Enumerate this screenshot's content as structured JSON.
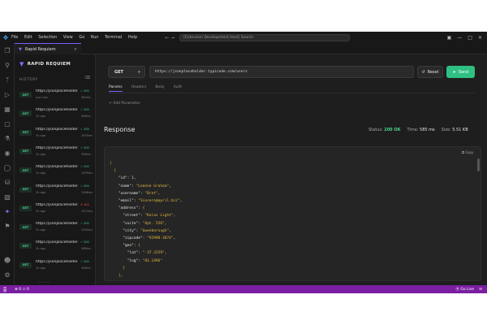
{
  "titlebar": {
    "menu": [
      "File",
      "Edit",
      "Selection",
      "View",
      "Go",
      "Run",
      "Terminal",
      "Help"
    ],
    "nav": "← →",
    "search": "[Extension Development Host] Search"
  },
  "tab": {
    "label": "Rapid Requiem",
    "close": "×"
  },
  "sidebar": {
    "brand": "RAPID REQUIEM",
    "history_label": "HISTORY",
    "items": [
      {
        "method": "GET",
        "url": "https://jsonplaceholder...",
        "ago": "just now",
        "status": "✓ 200",
        "time": "585ms",
        "error": false
      },
      {
        "method": "GET",
        "url": "https://jsonplaceholder...",
        "ago": "1h ago",
        "status": "✓ 200",
        "time": "588ms",
        "error": false
      },
      {
        "method": "GET",
        "url": "https://jsonplaceholder...",
        "ago": "1h ago",
        "status": "✓ 200",
        "time": "1055ms",
        "error": false
      },
      {
        "method": "GET",
        "url": "https://jsonplaceholder...",
        "ago": "1h ago",
        "status": "✓ 200",
        "time": "598ms",
        "error": false
      },
      {
        "method": "GET",
        "url": "https://jsonplaceholder...",
        "ago": "1h ago",
        "status": "✓ 200",
        "time": "1059ms",
        "error": false
      },
      {
        "method": "GET",
        "url": "https://jsonplaceholder...",
        "ago": "1h ago",
        "status": "✓ 200",
        "time": "1066ms",
        "error": false
      },
      {
        "method": "GET",
        "url": "https://jsonplaceholder...",
        "ago": "1h ago",
        "status": "✗ 404",
        "time": "1523ms",
        "error": true
      },
      {
        "method": "GET",
        "url": "https://jsonplaceholder...",
        "ago": "1h ago",
        "status": "✓ 200",
        "time": "1040ms",
        "error": false
      },
      {
        "method": "GET",
        "url": "https://jsonplaceholder...",
        "ago": "1h ago",
        "status": "✓ 200",
        "time": "588ms",
        "error": false
      },
      {
        "method": "GET",
        "url": "https://jsonplaceholder...",
        "ago": "1h ago",
        "status": "✓ 200",
        "time": "598ms",
        "error": false
      }
    ],
    "footer": "• • • • •"
  },
  "request": {
    "method": "GET",
    "url": "https://jsonplaceholder.typicode.com/users",
    "reset_label": "Reset",
    "send_label": "Send",
    "tabs": [
      "Params",
      "Headers",
      "Body",
      "Auth"
    ],
    "add_param": "+ Add Parameter"
  },
  "response": {
    "title": "Response",
    "status_label": "Status:",
    "status_value": "200 OK",
    "time_label": "Time:",
    "time_value": "585 ms",
    "size_label": "Size:",
    "size_value": "5.51 KB",
    "copy_label": "Copy",
    "lines": [
      "[",
      "  {",
      "    \"id\": 1,",
      "    \"name\": \"Leanne Graham\",",
      "    \"username\": \"Bret\",",
      "    \"email\": \"Sincere@april.biz\",",
      "    \"address\": {",
      "      \"street\": \"Kulas Light\",",
      "      \"suite\": \"Apt. 556\",",
      "      \"city\": \"Gwenborough\",",
      "      \"zipcode\": \"92998-3874\",",
      "      \"geo\": {",
      "        \"lat\": \"-37.3159\",",
      "        \"lng\": \"81.1496\"",
      "      }",
      "    },"
    ]
  },
  "statusbar": {
    "problems": "⊗ 0 ⚠ 0",
    "go_live": "Go Live"
  },
  "colors": {
    "accent": "#7b61ff",
    "send": "#2fbf82",
    "status_bar": "#7a1fa2",
    "ok": "#49d18c",
    "error": "#f0544f"
  }
}
